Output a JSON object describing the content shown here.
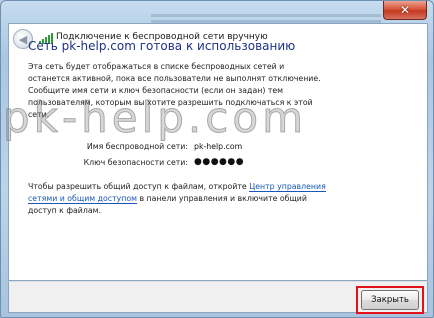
{
  "window": {
    "title": "Подключение к беспроводной сети вручную",
    "close_glyph": "✕"
  },
  "content": {
    "heading": "Сеть pk-help.com готова к использованию",
    "description": "Эта сеть будет отображаться в списке беспроводных сетей и останется активной, пока все пользователи не выполнят отключение. Сообщите имя сети и ключ безопасности (если он задан) тем пользователям, которым вы хотите разрешить подключаться к этой сети.",
    "fields": {
      "ssid_label": "Имя беспроводной сети:",
      "ssid_value": "pk-help.com",
      "key_label": "Ключ безопасности сети:",
      "key_value": "●●●●●●"
    },
    "share": {
      "prefix": "Чтобы разрешить общий доступ к файлам, откройте ",
      "link": "Центр управления сетями и общим доступом",
      "suffix": " в панели управления и включите общий доступ к файлам."
    }
  },
  "footer": {
    "close_label": "Закрыть"
  },
  "watermark": "pk-help.com",
  "icons": {
    "back": "back-arrow-icon",
    "network": "wireless-network-icon",
    "close": "close-icon"
  },
  "colors": {
    "heading": "#1e3287",
    "link": "#1a56b8",
    "highlight": "#e3121a",
    "close_button": "#c43a1e"
  }
}
